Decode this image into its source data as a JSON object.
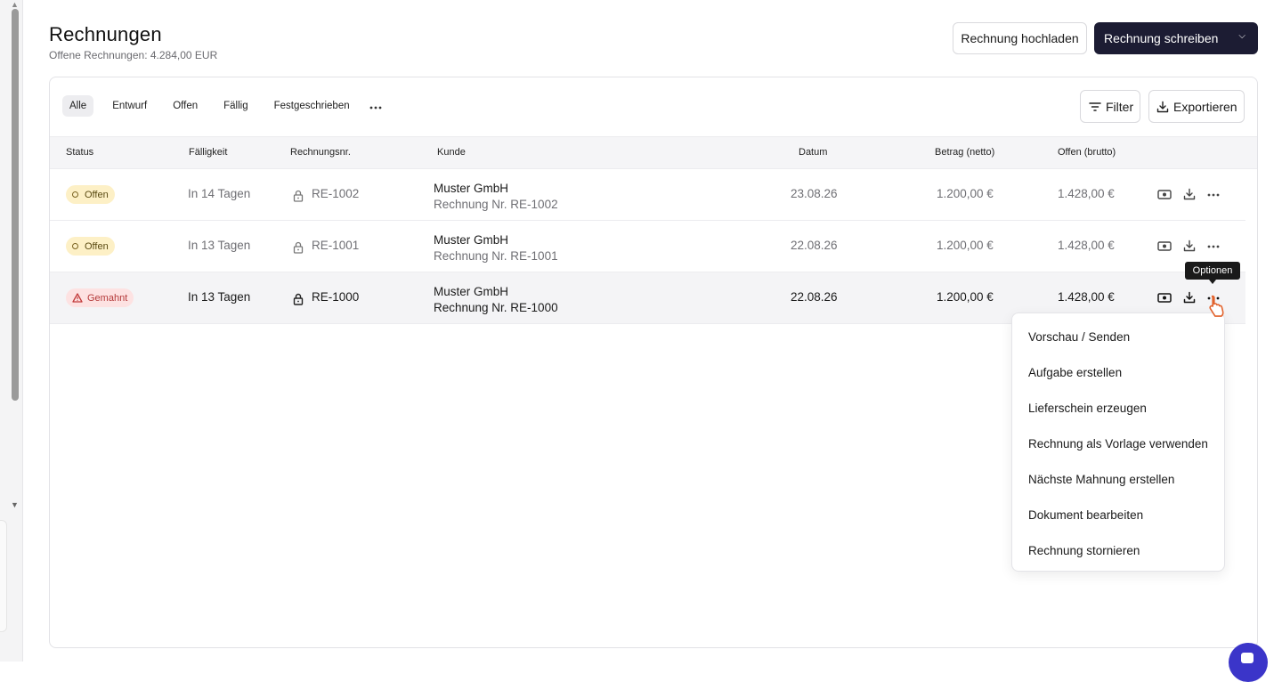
{
  "header": {
    "title": "Rechnungen",
    "subtitle": "Offene Rechnungen: 4.284,00 EUR"
  },
  "actions": {
    "upload_label": "Rechnung hochladen",
    "write_label": "Rechnung schreiben"
  },
  "tabs": [
    {
      "label": "Alle",
      "active": true
    },
    {
      "label": "Entwurf"
    },
    {
      "label": "Offen"
    },
    {
      "label": "Fällig"
    },
    {
      "label": "Festgeschrieben"
    }
  ],
  "toolbar": {
    "filter_label": "Filter",
    "export_label": "Exportieren"
  },
  "table": {
    "columns": {
      "status": "Status",
      "due": "Fälligkeit",
      "number": "Rechnungsnr.",
      "customer": "Kunde",
      "date": "Datum",
      "net": "Betrag (netto)",
      "open": "Offen (brutto)"
    },
    "rows": [
      {
        "status": "Offen",
        "due": "In 14 Tagen",
        "number": "RE-1002",
        "customer": "Muster GmbH",
        "customer_sub": "Rechnung Nr. RE-1002",
        "date": "23.08.26",
        "net": "1.200,00 €",
        "open": "1.428,00 €"
      },
      {
        "status": "Offen",
        "due": "In 13 Tagen",
        "number": "RE-1001",
        "customer": "Muster GmbH",
        "customer_sub": "Rechnung Nr. RE-1001",
        "date": "22.08.26",
        "net": "1.200,00 €",
        "open": "1.428,00 €"
      },
      {
        "status": "Gemahnt",
        "due": "In 13 Tagen",
        "number": "RE-1000",
        "customer": "Muster GmbH",
        "customer_sub": "Rechnung Nr. RE-1000",
        "date": "22.08.26",
        "net": "1.200,00 €",
        "open": "1.428,00 €"
      }
    ]
  },
  "tooltip": "Optionen",
  "menu": {
    "items": [
      "Vorschau / Senden",
      "Aufgabe erstellen",
      "Lieferschein erzeugen",
      "Rechnung als Vorlage verwenden",
      "Nächste Mahnung erstellen",
      "Dokument bearbeiten",
      "Rechnung stornieren"
    ]
  },
  "colors": {
    "primary_button": "#1c1c33",
    "badge_offen_bg": "#fdf0c6",
    "badge_gemahnt_bg": "#fde2e2",
    "badge_gemahnt_text": "#b43a3a",
    "chat_accent": "#3b35c9"
  }
}
